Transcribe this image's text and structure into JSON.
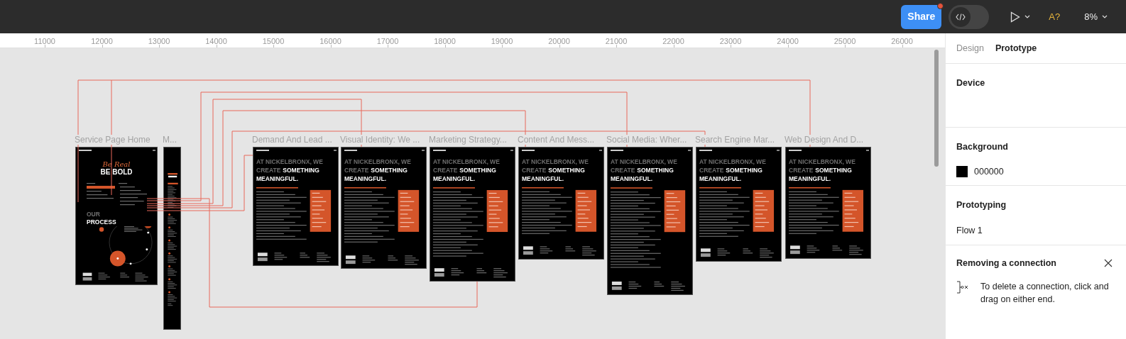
{
  "toolbar": {
    "share": "Share",
    "share_notification": true,
    "dev_mode": false,
    "accessibility": "A?",
    "zoom": "8%"
  },
  "ruler": {
    "labels": [
      "11000",
      "12000",
      "13000",
      "14000",
      "15000",
      "16000",
      "17000",
      "18000",
      "19000",
      "20000",
      "21000",
      "22000",
      "23000",
      "24000",
      "25000",
      "26000"
    ]
  },
  "canvas": {
    "frames": [
      {
        "kind": "home",
        "label": "Service Page Home",
        "script": "Be Real",
        "headline": "BE BOLD",
        "section": [
          "OUR",
          "PROCESS"
        ]
      },
      {
        "kind": "mobile",
        "label": "M..."
      },
      {
        "kind": "article",
        "label": "Demand And Lead ...",
        "headline": [
          "AT NICKELBRONX, WE",
          "CREATE",
          "SOMETHING",
          "MEANINGFUL."
        ]
      },
      {
        "kind": "article",
        "label": "Visual Identity: We ...",
        "headline": [
          "AT NICKELBRONX, WE",
          "CREATE",
          "SOMETHING",
          "MEANINGFUL."
        ]
      },
      {
        "kind": "article",
        "label": "Marketing Strategy...",
        "headline": [
          "AT NICKELBRONX, WE",
          "CREATE",
          "SOMETHING",
          "MEANINGFUL."
        ]
      },
      {
        "kind": "article",
        "label": "Content And Mess...",
        "headline": [
          "AT NICKELBRONX, WE",
          "CREATE",
          "SOMETHING",
          "MEANINGFUL."
        ]
      },
      {
        "kind": "article",
        "label": "Social Media: Wher...",
        "headline": [
          "AT NICKELBRONX, WE",
          "CREATE",
          "SOMETHING",
          "MEANINGFUL."
        ]
      },
      {
        "kind": "article",
        "label": "Search Engine Mar...",
        "headline": [
          "AT NICKELBRONX, WE",
          "CREATE",
          "SOMETHING",
          "MEANINGFUL."
        ]
      },
      {
        "kind": "article",
        "label": "Web Design And D...",
        "headline": [
          "AT NICKELBRONX, WE",
          "CREATE",
          "SOMETHING",
          "MEANINGFUL."
        ]
      }
    ]
  },
  "panel": {
    "tabs": [
      {
        "label": "Design",
        "selected": false
      },
      {
        "label": "Prototype",
        "selected": true
      }
    ],
    "device": {
      "title": "Device"
    },
    "background": {
      "title": "Background",
      "value": "000000"
    },
    "prototyping": {
      "title": "Prototyping",
      "flow": "Flow 1"
    },
    "tip": {
      "title": "Removing a connection",
      "text": "To delete a connection, click and drag on either end."
    }
  }
}
